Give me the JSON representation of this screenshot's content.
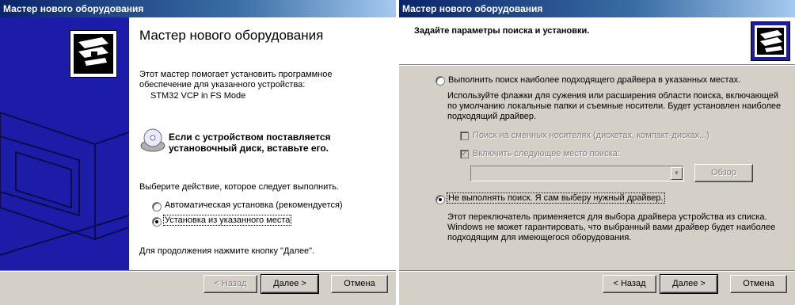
{
  "wizard1": {
    "title": "Мастер нового оборудования",
    "heading": "Мастер нового оборудования",
    "intro_line1": "Этот мастер помогает установить программное",
    "intro_line2": "обеспечение для указанного устройства:",
    "device": "STM32 VCP in FS Mode",
    "cd_line1": "Если с устройством поставляется",
    "cd_line2": "установочный диск, вставьте его.",
    "choose": "Выберите действие, которое следует выполнить.",
    "option_auto": "Автоматическая установка (рекомендуется)",
    "option_manual": "Установка из указанного места",
    "selected_option": "option_manual",
    "continue_text": "Для продолжения нажмите кнопку \"Далее\".",
    "buttons": {
      "back": "< Назад",
      "next": "Далее >",
      "cancel": "Отмена"
    },
    "icons": [
      "hardware-wizard-icon",
      "cd-install-icon"
    ]
  },
  "wizard2": {
    "title": "Мастер нового оборудования",
    "heading": "Задайте параметры поиска и установки.",
    "option_search": "Выполнить поиск наиболее подходящего драйвера в указанных местах.",
    "search_desc1": "Используйте флажки для сужения или расширения области поиска, включающей",
    "search_desc2": "по умолчанию локальные папки и съемные носители. Будет установлен наиболее",
    "search_desc3": "подходящий драйвер.",
    "chk_removable": "Поиск на сменных носителях (дискетах, компакт-дисках...)",
    "chk_removable_checked": false,
    "chk_location": "Включить следующее место поиска:",
    "chk_location_checked": true,
    "path_value": "",
    "browse": "Обзор",
    "option_manual": "Не выполнять поиск. Я сам выберу нужный драйвер.",
    "selected_option": "option_manual",
    "manual_desc1": "Этот переключатель применяется для выбора драйвера устройства из списка.",
    "manual_desc2": "Windows не может гарантировать, что выбранный вами драйвер будет наиболее",
    "manual_desc3": "подходящим для имеющегося оборудования.",
    "buttons": {
      "back": "< Назад",
      "next": "Далее >",
      "cancel": "Отмена"
    },
    "icons": [
      "hardware-wizard-icon"
    ]
  },
  "colors": {
    "title_bar": "#0a246a",
    "banner": "#1c1ca8",
    "face": "#d4d0c8"
  }
}
